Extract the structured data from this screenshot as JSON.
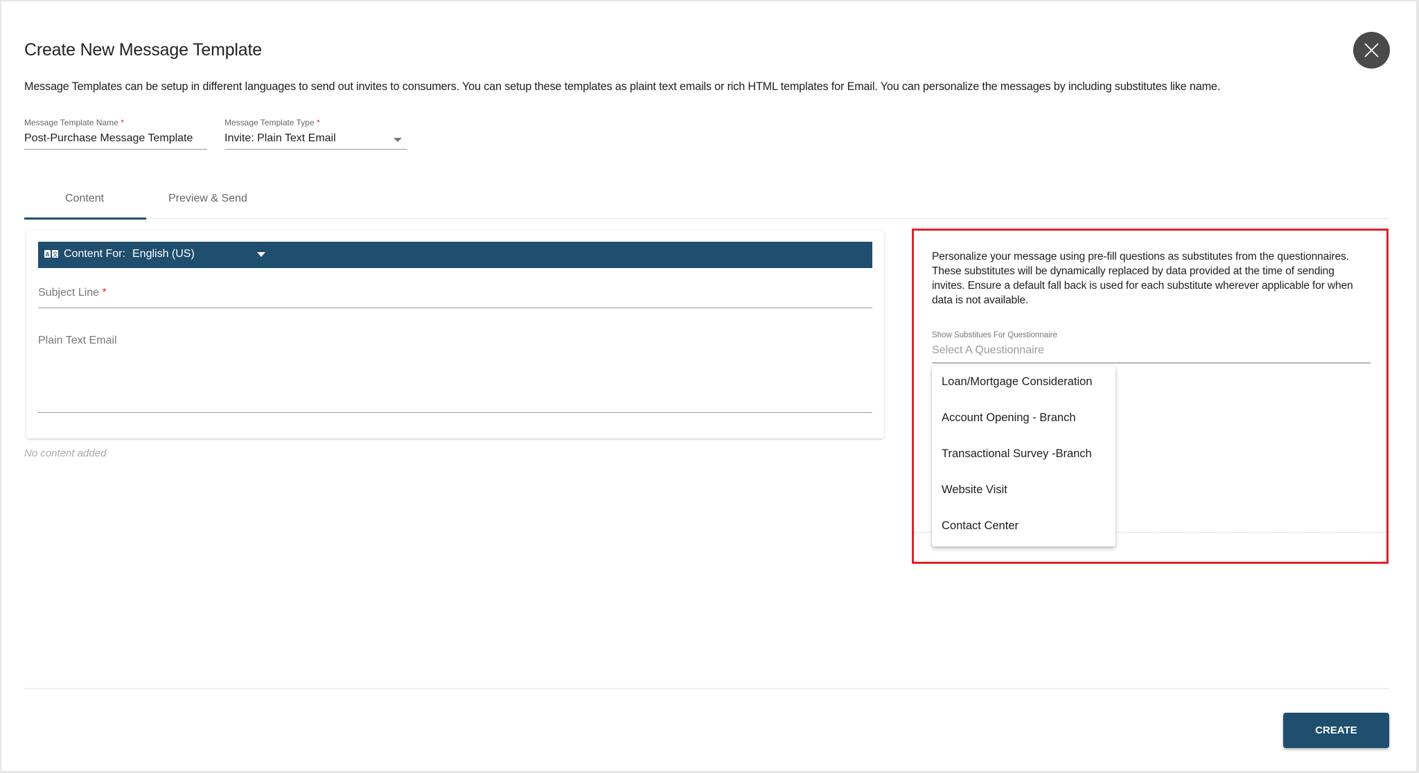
{
  "dialog": {
    "title": "Create New Message Template",
    "description": "Message Templates can be setup in different languages to send out invites to consumers. You can setup these templates as plaint text emails or rich HTML templates for Email. You can personalize the messages by including substitutes like name.",
    "close_icon": "close-icon"
  },
  "fields": {
    "name": {
      "label": "Message Template Name",
      "required_mark": "*",
      "value": "Post-Purchase Message Template"
    },
    "type": {
      "label": "Message Template Type",
      "required_mark": "*",
      "value": "Invite: Plain Text Email"
    }
  },
  "tabs": [
    {
      "label": "Content",
      "active": true
    },
    {
      "label": "Preview & Send",
      "active": false
    }
  ],
  "content": {
    "language_bar": {
      "icon": "translate-icon",
      "label": "Content For:",
      "value": "English (US)"
    },
    "subject": {
      "placeholder": "Subject Line",
      "required_mark": "*"
    },
    "body": {
      "placeholder": "Plain Text Email"
    },
    "empty_note": "No content added"
  },
  "substitutes": {
    "description": "Personalize your message using pre-fill questions as substitutes from the questionnaires. These substitutes will be dynamically replaced by data provided at the time of sending invites. Ensure a default fall back is used for each substitute wherever applicable for when data is not available.",
    "select_label": "Show Substitues For Questionnaire",
    "select_placeholder": "Select A Questionnaire",
    "options": [
      "Loan/Mortgage Consideration",
      "Account Opening - Branch",
      "Transactional Survey -Branch",
      "Website Visit",
      "Contact Center"
    ]
  },
  "footer": {
    "create_label": "CREATE"
  },
  "colors": {
    "primary": "#1f4e6e",
    "highlight": "#e0202a",
    "required": "#e02b2b",
    "close_bg": "#4a4a4a"
  }
}
